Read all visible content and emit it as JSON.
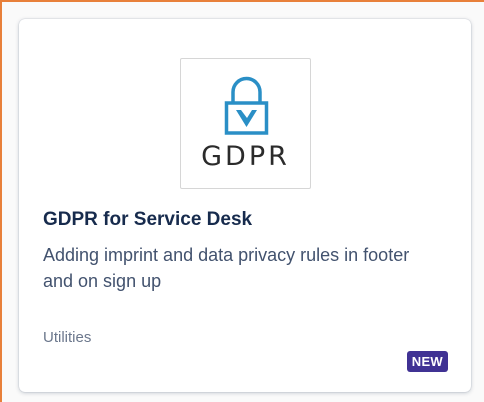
{
  "app_card": {
    "logo_text": "GDPR",
    "title": "GDPR for Service Desk",
    "description": "Adding imprint and data privacy rules in footer and on sign up",
    "category": "Utilities",
    "badge": "NEW"
  },
  "colors": {
    "logo_accent": "#2a8fc6",
    "badge_bg": "#403294",
    "title": "#172b4d",
    "frame_border": "#e8803a"
  }
}
